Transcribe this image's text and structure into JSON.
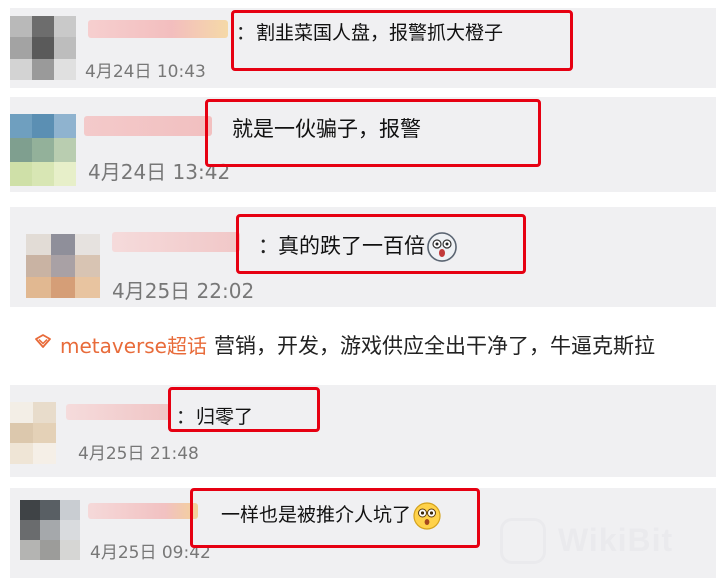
{
  "comments": [
    {
      "text": "割韭菜国人盘，报警抓大橙子",
      "time": "4月24日 10:43"
    },
    {
      "text": "就是一伙骗子，报警",
      "time": "4月24日 13:42"
    },
    {
      "text": "真的跌了一百倍",
      "time": "4月25日 22:02",
      "emoji": "dizzy-face-emoji"
    },
    {
      "text": "归零了",
      "time": "4月25日 21:48"
    },
    {
      "text": "一样也是被推介人坑了",
      "time": "4月25日 09:42",
      "emoji": "flushed-face-emoji"
    }
  ],
  "topic": {
    "icon": "super-topic-icon",
    "tag": "metaverse超话",
    "text": "营销，开发，游戏供应全出干净了，牛逼克斯拉",
    "tag_color": "#e86b3a"
  },
  "colon": "：",
  "highlight_color": "#e60012",
  "watermark": {
    "text": "WikiBit"
  }
}
